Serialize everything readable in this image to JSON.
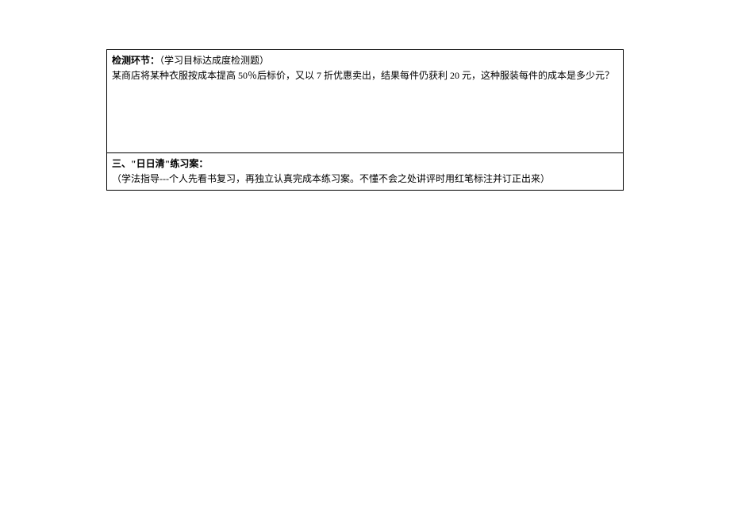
{
  "section1": {
    "title": "检测环节：",
    "subtitle": "（学习目标达成度检测题）",
    "problem": "某商店将某种衣服按成本提高 50％后标价，又以 7 折优惠卖出，结果每件仍获利 20 元，这种服装每件的成本是多少元？"
  },
  "section2": {
    "title": "三、\"日日清\"练习案：",
    "instruction": "（学法指导---个人先看书复习，再独立认真完成本练习案。不懂不会之处讲评时用红笔标注并订正出来）"
  }
}
